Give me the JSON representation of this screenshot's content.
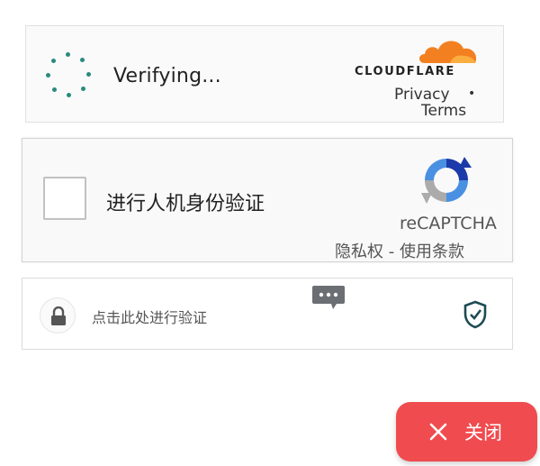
{
  "cloudflare": {
    "status": "Verifying...",
    "brand": "CLOUDFLARE",
    "privacy": "Privacy",
    "separator": "•",
    "terms": "Terms",
    "brand_color": "#f38020"
  },
  "recaptcha": {
    "checkbox_label": "进行人机身份验证",
    "brand": "reCAPTCHA",
    "links": "隐私权 - 使用条款"
  },
  "third_widget": {
    "prompt": "点击此处进行验证",
    "icons": [
      "lock-icon",
      "chat-bubble-icon",
      "shield-check-icon"
    ]
  },
  "close_button": {
    "label": "关闭",
    "color": "#f04b4f"
  }
}
